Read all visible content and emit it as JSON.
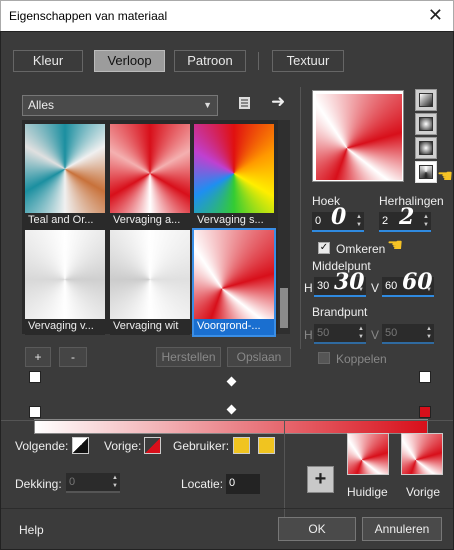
{
  "window": {
    "title": "Eigenschappen van materiaal",
    "close_glyph": "✕"
  },
  "tabs": [
    {
      "label": "Kleur",
      "active": false
    },
    {
      "label": "Verloop",
      "active": true
    },
    {
      "label": "Patroon",
      "active": false
    },
    {
      "label": "Textuur",
      "active": false
    }
  ],
  "library": {
    "selected": "Alles",
    "thumbnails": [
      {
        "label": "Teal and Or..."
      },
      {
        "label": "Vervaging a..."
      },
      {
        "label": "Vervaging s..."
      },
      {
        "label": "Vervaging v..."
      },
      {
        "label": "Vervaging wit"
      },
      {
        "label": "Voorgrond-...",
        "selected": true
      }
    ]
  },
  "buttons": {
    "add": "+",
    "remove": "-",
    "restore": "Herstellen",
    "save": "Opslaan"
  },
  "settings": {
    "angle_label": "Hoek",
    "angle_value": "0",
    "repeats_label": "Herhalingen",
    "repeats_value": "2",
    "invert_label": "Omkeren",
    "invert_checked": true,
    "midpoint_label": "Middelpunt",
    "midpoint_h_label": "H",
    "midpoint_h": "30",
    "midpoint_v_label": "V",
    "midpoint_v": "60",
    "focal_label": "Brandpunt",
    "focal_h_label": "H",
    "focal_h": "50",
    "focal_v_label": "V",
    "focal_v": "50",
    "link_label": "Koppelen",
    "link_checked": false
  },
  "annotations": {
    "angle": "0",
    "repeats": "2",
    "mid_h": "30",
    "mid_v": "60"
  },
  "gradient_editor": {
    "next_label": "Volgende:",
    "prev_label": "Vorige:",
    "user_label": "Gebruiker:",
    "opacity_label": "Dekking:",
    "opacity_value": "0",
    "location_label": "Locatie:",
    "location_value": "0",
    "current_label": "Huidige",
    "previous_label": "Vorige",
    "add_glyph": "+"
  },
  "colors": {
    "accent": "#d80f1a",
    "user": "#f0c420",
    "highlight": "#1a6fd0"
  },
  "footer": {
    "help": "Help",
    "ok": "OK",
    "cancel": "Annuleren"
  }
}
